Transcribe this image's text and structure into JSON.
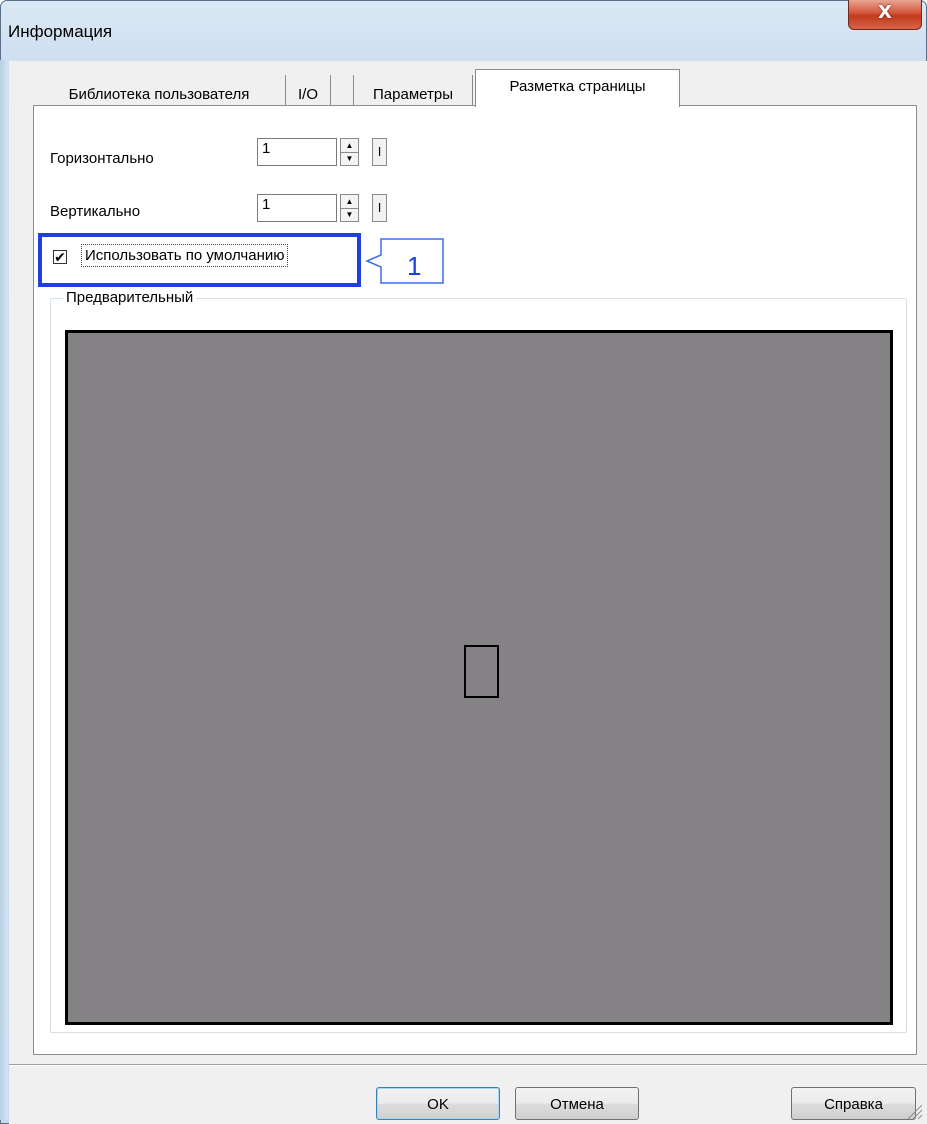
{
  "window": {
    "title": "Информация",
    "close_glyph": "X"
  },
  "tabs": [
    {
      "label": "Библиотека пользователя",
      "active": false
    },
    {
      "label": "I/O",
      "active": false
    },
    {
      "label": "Параметры",
      "active": false
    },
    {
      "label": "Разметка страницы",
      "active": true
    }
  ],
  "fields": {
    "horizontal": {
      "label": "Горизонтально",
      "value": "1"
    },
    "vertical": {
      "label": "Вертикально",
      "value": "1"
    }
  },
  "small_button_label": "I",
  "use_default": {
    "label": "Использовать по умолчанию",
    "checked": true,
    "check_glyph": "✔"
  },
  "annotation": {
    "number": "1",
    "color": "#1f3fe0"
  },
  "preview": {
    "group_label": "Предварительный",
    "background": "#858285"
  },
  "buttons": {
    "ok": "OK",
    "cancel": "Отмена",
    "help": "Справка"
  }
}
